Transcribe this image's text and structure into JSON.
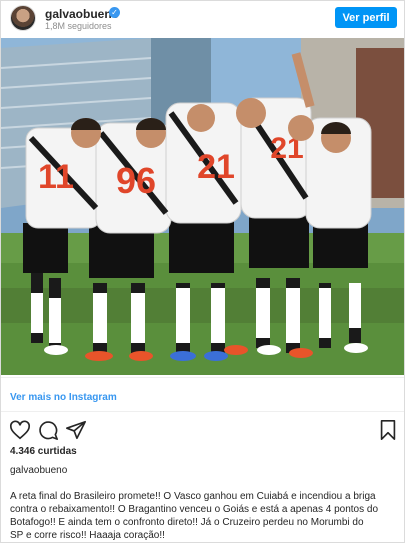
{
  "header": {
    "username": "galvaobueno",
    "verified_icon": "verified-badge-icon",
    "followers": "1,8M seguidores",
    "follow_button": "Ver perfil"
  },
  "post": {
    "photo_description_icon": "team-huddle-photo",
    "carousel": {
      "count": 3,
      "active": 1
    },
    "jerseys": [
      "11",
      "96",
      "21",
      "21"
    ],
    "view_more": "Ver mais no Instagram",
    "likes": "4.346 curtidas",
    "poster": "galvaobueno",
    "caption_lines": [
      "A reta final do Brasileiro promete!! O Vasco ganhou em Cuiabá e incendiou a briga",
      "contra o rebaixamento!! O Bragantino venceu o Goiás e está a apenas 4 pontos do",
      "Botafogo!! E ainda tem o confronto direto!! Já o Cruzeiro perdeu no Morumbi do",
      "SP e corre risco!! Haaaja coração!!"
    ]
  },
  "colors": {
    "accent": "#0095f6",
    "link": "#3897f0",
    "text": "#262626",
    "muted": "#8e8e8e"
  }
}
